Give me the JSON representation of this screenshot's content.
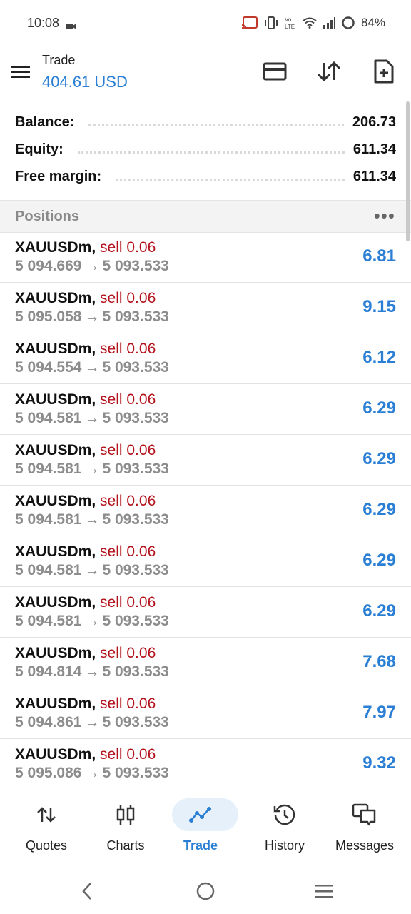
{
  "status_bar": {
    "time": "10:08",
    "battery": "84%"
  },
  "header": {
    "title": "Trade",
    "amount": "404.61 USD"
  },
  "summary": [
    {
      "label": "Balance:",
      "value": "206.73"
    },
    {
      "label": "Equity:",
      "value": "611.34"
    },
    {
      "label": "Free margin:",
      "value": "611.34"
    }
  ],
  "positions": {
    "title": "Positions",
    "more": "•••",
    "items": [
      {
        "symbol": "XAUUSDm,",
        "side": "sell 0.06",
        "open": "5 094.669",
        "arrow": "→",
        "current": "5 093.533",
        "profit": "6.81"
      },
      {
        "symbol": "XAUUSDm,",
        "side": "sell 0.06",
        "open": "5 095.058",
        "arrow": "→",
        "current": "5 093.533",
        "profit": "9.15"
      },
      {
        "symbol": "XAUUSDm,",
        "side": "sell 0.06",
        "open": "5 094.554",
        "arrow": "→",
        "current": "5 093.533",
        "profit": "6.12"
      },
      {
        "symbol": "XAUUSDm,",
        "side": "sell 0.06",
        "open": "5 094.581",
        "arrow": "→",
        "current": "5 093.533",
        "profit": "6.29"
      },
      {
        "symbol": "XAUUSDm,",
        "side": "sell 0.06",
        "open": "5 094.581",
        "arrow": "→",
        "current": "5 093.533",
        "profit": "6.29"
      },
      {
        "symbol": "XAUUSDm,",
        "side": "sell 0.06",
        "open": "5 094.581",
        "arrow": "→",
        "current": "5 093.533",
        "profit": "6.29"
      },
      {
        "symbol": "XAUUSDm,",
        "side": "sell 0.06",
        "open": "5 094.581",
        "arrow": "→",
        "current": "5 093.533",
        "profit": "6.29"
      },
      {
        "symbol": "XAUUSDm,",
        "side": "sell 0.06",
        "open": "5 094.581",
        "arrow": "→",
        "current": "5 093.533",
        "profit": "6.29"
      },
      {
        "symbol": "XAUUSDm,",
        "side": "sell 0.06",
        "open": "5 094.814",
        "arrow": "→",
        "current": "5 093.533",
        "profit": "7.68"
      },
      {
        "symbol": "XAUUSDm,",
        "side": "sell 0.06",
        "open": "5 094.861",
        "arrow": "→",
        "current": "5 093.533",
        "profit": "7.97"
      },
      {
        "symbol": "XAUUSDm,",
        "side": "sell 0.06",
        "open": "5 095.086",
        "arrow": "→",
        "current": "5 093.533",
        "profit": "9.32"
      }
    ]
  },
  "bottom_nav": {
    "quotes": "Quotes",
    "charts": "Charts",
    "trade": "Trade",
    "history": "History",
    "messages": "Messages"
  },
  "colors": {
    "accent": "#2a7fd4",
    "sell": "#b3121c",
    "muted": "#8c8c8c"
  }
}
